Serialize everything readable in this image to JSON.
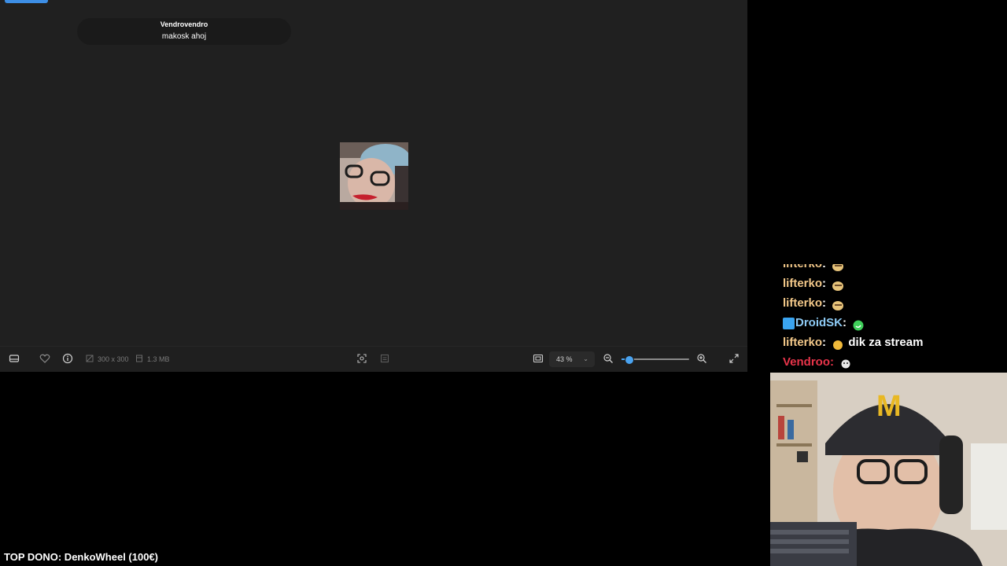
{
  "toast": {
    "sender": "Vendrovendro",
    "message": "makosk ahoj"
  },
  "toolbar": {
    "dimensions": "300 x 300",
    "file_size": "1.3 MB",
    "zoom_value": "43 %",
    "zoom_level": 0.1,
    "icons": [
      "filmstrip-icon",
      "heart-icon",
      "info-icon",
      "image-size-icon",
      "file-size-icon",
      "visual-search-icon",
      "crop-icon",
      "fit-to-window-icon",
      "chevron-down-icon",
      "zoom-out-icon",
      "zoom-in-icon",
      "fullscreen-icon"
    ]
  },
  "chat": {
    "lines": [
      {
        "user": "lifterko",
        "color": "#f4c98a",
        "sep": ":",
        "text": ""
      },
      {
        "user": "lifterko",
        "color": "#f4c98a",
        "sep": ":",
        "text": ""
      },
      {
        "user": "lifterko",
        "color": "#f4c98a",
        "sep": ":",
        "text": ""
      },
      {
        "user": "DroidSK",
        "color": "#8ecbf5",
        "sep": ":",
        "text": ""
      },
      {
        "user": "lifterko",
        "color": "#f4c98a",
        "sep": ":",
        "text": "dik za stream"
      },
      {
        "user": "Vendroo",
        "color": "#e8344a",
        "sep": ":",
        "text": ""
      }
    ]
  },
  "overlay": {
    "top_dono": "TOP DONO: DenkoWheel (100€)"
  },
  "colors": {
    "accent": "#3d8ee5",
    "slider": "#4aa3f0",
    "viewer_bg": "#202020"
  }
}
